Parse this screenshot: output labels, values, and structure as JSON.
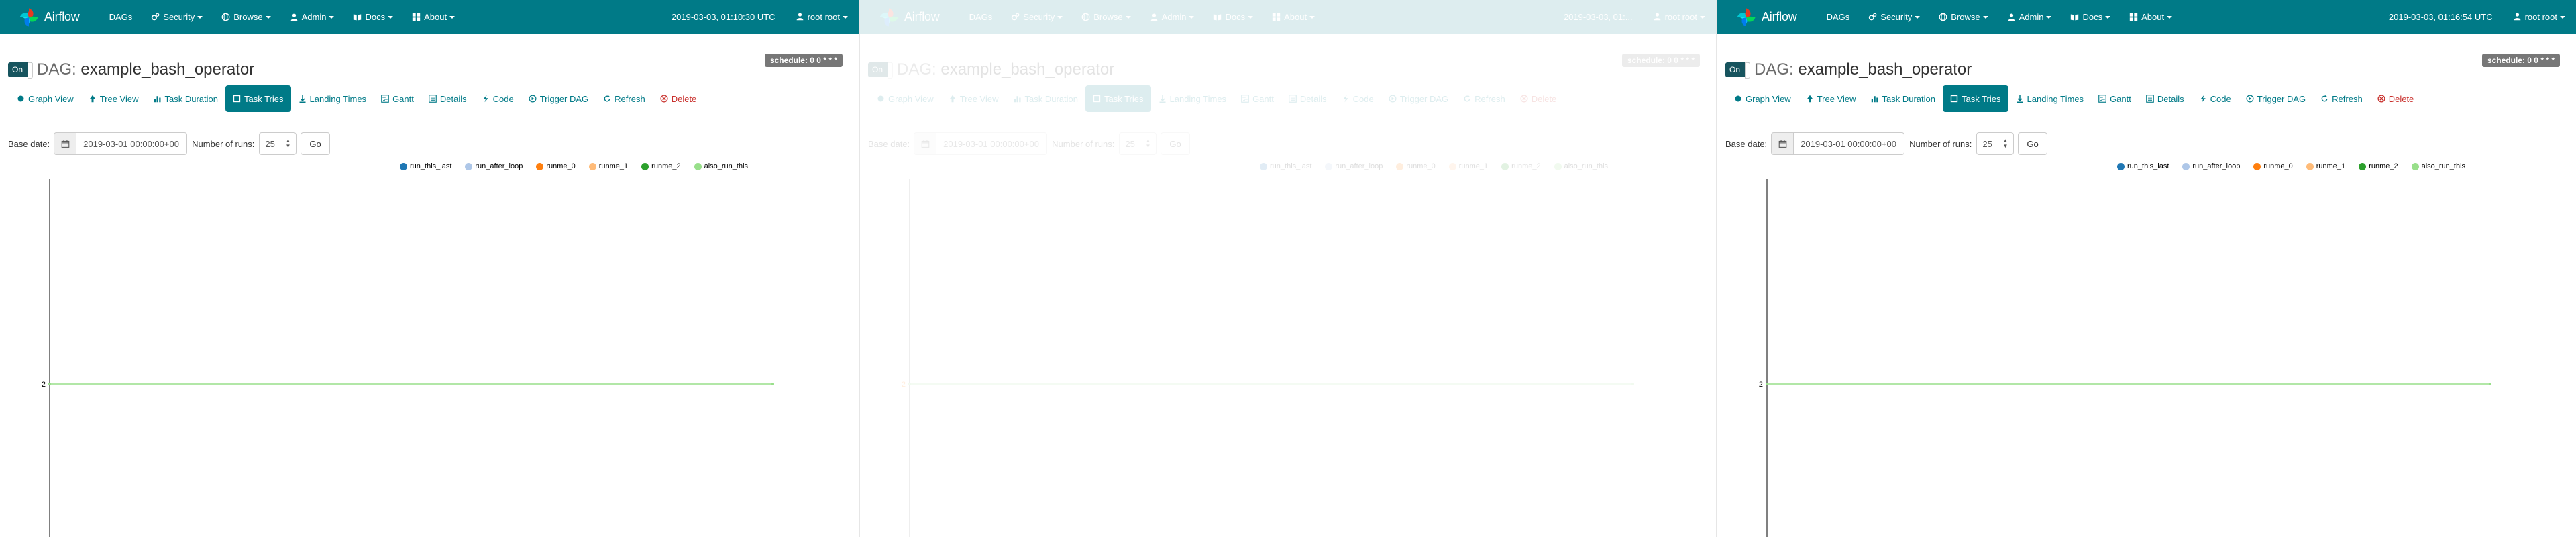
{
  "panels": [
    {
      "navbar": {
        "brand": "Airflow",
        "items": [
          {
            "label": "DAGs",
            "icon": "none",
            "dropdown": false
          },
          {
            "label": "Security",
            "icon": "cogs-icon",
            "dropdown": true
          },
          {
            "label": "Browse",
            "icon": "globe-icon",
            "dropdown": true
          },
          {
            "label": "Admin",
            "icon": "user-icon",
            "dropdown": true
          },
          {
            "label": "Docs",
            "icon": "book-icon",
            "dropdown": true
          },
          {
            "label": "About",
            "icon": "grid-icon",
            "dropdown": true
          }
        ],
        "time": "2019-03-03, 01:10:30 UTC",
        "user": "root root"
      },
      "toggle_label": "On",
      "dag_prefix": "DAG:",
      "dag_id": "example_bash_operator",
      "schedule": "schedule: 0 0 * * *",
      "tabs": [
        {
          "label": "Graph View",
          "icon": "graph-icon"
        },
        {
          "label": "Tree View",
          "icon": "tree-icon"
        },
        {
          "label": "Task Duration",
          "icon": "bar-chart-icon"
        },
        {
          "label": "Task Tries",
          "icon": "square-icon"
        },
        {
          "label": "Landing Times",
          "icon": "landing-icon"
        },
        {
          "label": "Gantt",
          "icon": "gantt-icon"
        },
        {
          "label": "Details",
          "icon": "list-icon"
        },
        {
          "label": "Code",
          "icon": "bolt-icon"
        },
        {
          "label": "Trigger DAG",
          "icon": "trigger-icon"
        },
        {
          "label": "Refresh",
          "icon": "refresh-icon"
        },
        {
          "label": "Delete",
          "icon": "delete-icon"
        }
      ],
      "active_tab": "Task Tries",
      "form": {
        "base_date_label": "Base date:",
        "base_date_value": "2019-03-01 00:00:00+00:00",
        "runs_label": "Number of runs:",
        "runs_value": "25",
        "go_label": "Go"
      },
      "chart_data": {
        "type": "line",
        "series": [
          {
            "name": "run_this_last",
            "color": "#1f77b4",
            "values": []
          },
          {
            "name": "run_after_loop",
            "color": "#aec7e8",
            "values": []
          },
          {
            "name": "runme_0",
            "color": "#ff7f0e",
            "values": []
          },
          {
            "name": "runme_1",
            "color": "#ffbb78",
            "values": []
          },
          {
            "name": "runme_2",
            "color": "#2ca02c",
            "values": []
          },
          {
            "name": "also_run_this",
            "color": "#98df8a",
            "values": [
              2,
              2
            ]
          }
        ],
        "y_ticks": [
          "2"
        ],
        "visible_line_color": "#98df8a"
      }
    },
    {
      "navbar": {
        "brand": "Airflow",
        "items": [
          {
            "label": "DAGs",
            "icon": "none",
            "dropdown": false
          },
          {
            "label": "Security",
            "icon": "cogs-icon",
            "dropdown": true
          },
          {
            "label": "Browse",
            "icon": "globe-icon",
            "dropdown": true
          },
          {
            "label": "Admin",
            "icon": "user-icon",
            "dropdown": true
          },
          {
            "label": "Docs",
            "icon": "book-icon",
            "dropdown": true
          },
          {
            "label": "About",
            "icon": "grid-icon",
            "dropdown": true
          }
        ],
        "time": "2019-03-03, 01:...",
        "user": "root root"
      },
      "toggle_label": "On",
      "dag_prefix": "DAG:",
      "dag_id": "example_bash_operator",
      "schedule": "schedule: 0 0 * * *",
      "tabs": [
        {
          "label": "Graph View",
          "icon": "graph-icon"
        },
        {
          "label": "Tree View",
          "icon": "tree-icon"
        },
        {
          "label": "Task Duration",
          "icon": "bar-chart-icon"
        },
        {
          "label": "Task Tries",
          "icon": "square-icon"
        },
        {
          "label": "Landing Times",
          "icon": "landing-icon"
        },
        {
          "label": "Gantt",
          "icon": "gantt-icon"
        },
        {
          "label": "Details",
          "icon": "list-icon"
        },
        {
          "label": "Code",
          "icon": "bolt-icon"
        },
        {
          "label": "Trigger DAG",
          "icon": "trigger-icon"
        },
        {
          "label": "Refresh",
          "icon": "refresh-icon"
        },
        {
          "label": "Delete",
          "icon": "delete-icon"
        }
      ],
      "active_tab": "Task Tries",
      "form": {
        "base_date_label": "Base date:",
        "base_date_value": "2019-03-01 00:00:00+00:00",
        "runs_label": "Number of runs:",
        "runs_value": "25",
        "go_label": "Go"
      },
      "chart_data": {
        "type": "line",
        "series": [
          {
            "name": "run_this_last",
            "color": "#1f77b4",
            "values": []
          },
          {
            "name": "run_after_loop",
            "color": "#aec7e8",
            "values": []
          },
          {
            "name": "runme_0",
            "color": "#ff7f0e",
            "values": []
          },
          {
            "name": "runme_1",
            "color": "#ffbb78",
            "values": []
          },
          {
            "name": "runme_2",
            "color": "#2ca02c",
            "values": []
          },
          {
            "name": "also_run_this",
            "color": "#98df8a",
            "values": [
              2,
              2
            ]
          }
        ],
        "y_ticks": [
          "2"
        ],
        "visible_line_color": "#98df8a"
      }
    },
    {
      "navbar": {
        "brand": "Airflow",
        "items": [
          {
            "label": "DAGs",
            "icon": "none",
            "dropdown": false
          },
          {
            "label": "Security",
            "icon": "cogs-icon",
            "dropdown": true
          },
          {
            "label": "Browse",
            "icon": "globe-icon",
            "dropdown": true
          },
          {
            "label": "Admin",
            "icon": "user-icon",
            "dropdown": true
          },
          {
            "label": "Docs",
            "icon": "book-icon",
            "dropdown": true
          },
          {
            "label": "About",
            "icon": "grid-icon",
            "dropdown": true
          }
        ],
        "time": "2019-03-03, 01:16:54 UTC",
        "user": "root root"
      },
      "toggle_label": "On",
      "dag_prefix": "DAG:",
      "dag_id": "example_bash_operator",
      "schedule": "schedule: 0 0 * * *",
      "tabs": [
        {
          "label": "Graph View",
          "icon": "graph-icon"
        },
        {
          "label": "Tree View",
          "icon": "tree-icon"
        },
        {
          "label": "Task Duration",
          "icon": "bar-chart-icon"
        },
        {
          "label": "Task Tries",
          "icon": "square-icon"
        },
        {
          "label": "Landing Times",
          "icon": "landing-icon"
        },
        {
          "label": "Gantt",
          "icon": "gantt-icon"
        },
        {
          "label": "Details",
          "icon": "list-icon"
        },
        {
          "label": "Code",
          "icon": "bolt-icon"
        },
        {
          "label": "Trigger DAG",
          "icon": "trigger-icon"
        },
        {
          "label": "Refresh",
          "icon": "refresh-icon"
        },
        {
          "label": "Delete",
          "icon": "delete-icon"
        }
      ],
      "active_tab": "Task Tries",
      "form": {
        "base_date_label": "Base date:",
        "base_date_value": "2019-03-01 00:00:00+00:00",
        "runs_label": "Number of runs:",
        "runs_value": "25",
        "go_label": "Go"
      },
      "chart_data": {
        "type": "line",
        "series": [
          {
            "name": "run_this_last",
            "color": "#1f77b4",
            "values": []
          },
          {
            "name": "run_after_loop",
            "color": "#aec7e8",
            "values": []
          },
          {
            "name": "runme_0",
            "color": "#ff7f0e",
            "values": []
          },
          {
            "name": "runme_1",
            "color": "#ffbb78",
            "values": []
          },
          {
            "name": "runme_2",
            "color": "#2ca02c",
            "values": []
          },
          {
            "name": "also_run_this",
            "color": "#98df8a",
            "values": [
              2,
              2
            ]
          }
        ],
        "y_ticks": [
          "2"
        ],
        "visible_line_color": "#98df8a"
      }
    }
  ],
  "colors": {
    "navbar": "#007a87",
    "active_tab": "#007a87",
    "link": "#007a87",
    "delete": "#c9302c",
    "toggle": "#17545e",
    "badge": "#777777"
  }
}
